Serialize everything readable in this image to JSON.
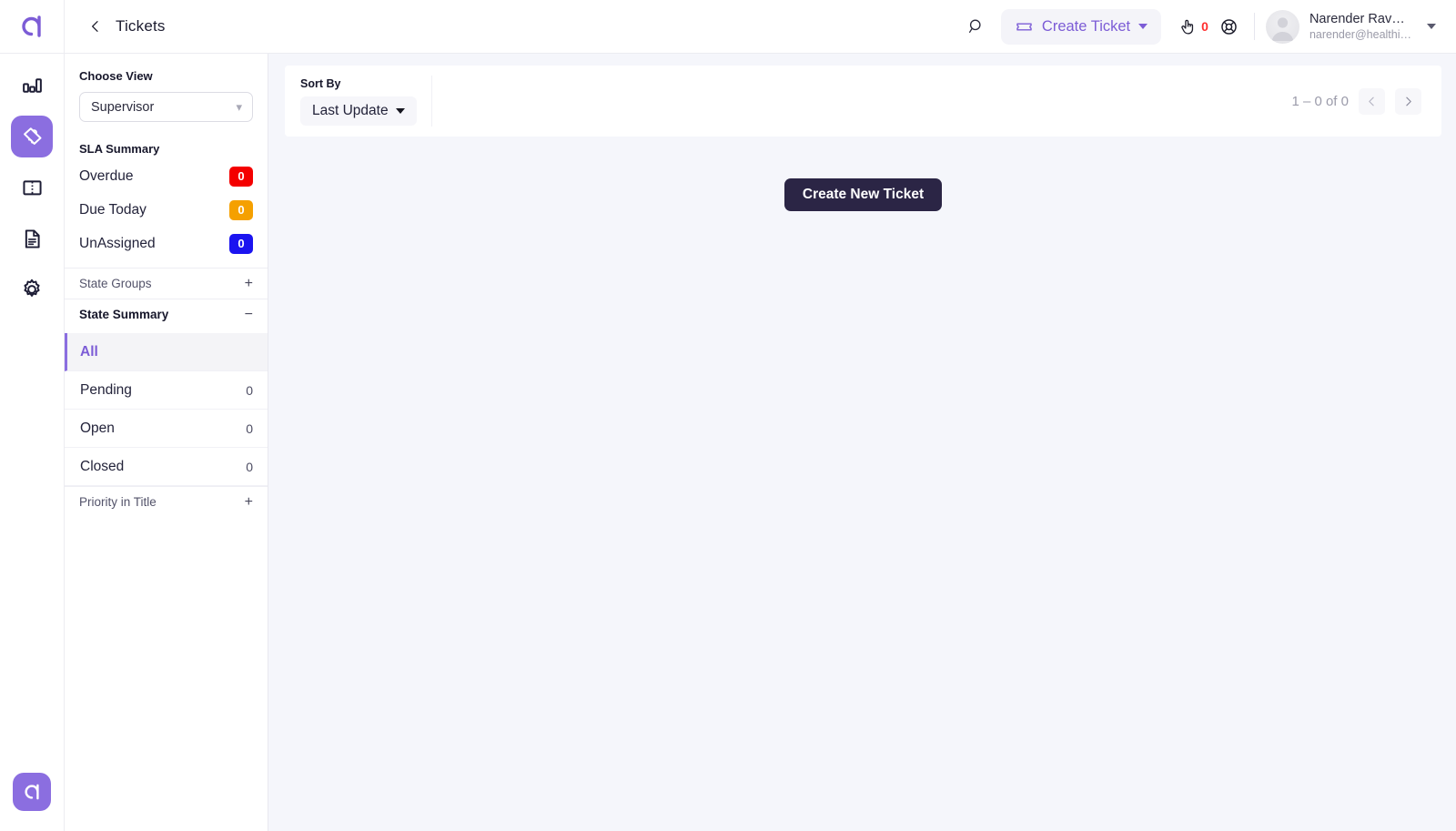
{
  "brand": {
    "logo_glyph": "a",
    "accent": "#8b6ee0",
    "bottom_logo_glyph": "a"
  },
  "rail": {
    "items": [
      {
        "name": "dashboard",
        "icon": "bar-chart-icon",
        "active": false
      },
      {
        "name": "tickets",
        "icon": "ticket-icon",
        "active": true
      },
      {
        "name": "knowledge-base",
        "icon": "book-icon",
        "active": false
      },
      {
        "name": "reports",
        "icon": "document-icon",
        "active": false
      },
      {
        "name": "settings",
        "icon": "gear-icon",
        "active": false
      }
    ]
  },
  "header": {
    "title": "Tickets",
    "back_icon": "chevron-left-icon",
    "search_icon": "search-icon",
    "create_ticket_label": "Create Ticket",
    "create_ticket_icon": "ticket-icon",
    "cursor_icon": "hand-pointer-icon",
    "cursor_badge": "0",
    "help_icon": "lifebuoy-icon",
    "user_name": "Narender Rav…",
    "user_email": "narender@healthi…"
  },
  "sidebar": {
    "choose_view_label": "Choose View",
    "choose_view_value": "Supervisor",
    "sla_summary_label": "SLA Summary",
    "sla_rows": [
      {
        "label": "Overdue",
        "count": "0",
        "color": "#f40000"
      },
      {
        "label": "Due Today",
        "count": "0",
        "color": "#f5a000"
      },
      {
        "label": "UnAssigned",
        "count": "0",
        "color": "#1b14f0"
      }
    ],
    "state_groups_label": "State Groups",
    "state_groups_sign": "+",
    "state_summary_label": "State Summary",
    "state_summary_sign": "−",
    "states": [
      {
        "label": "All",
        "count": "",
        "active": true
      },
      {
        "label": "Pending",
        "count": "0",
        "active": false
      },
      {
        "label": "Open",
        "count": "0",
        "active": false
      },
      {
        "label": "Closed",
        "count": "0",
        "active": false
      }
    ],
    "priority_label": "Priority in Title",
    "priority_sign": "+"
  },
  "toolbar": {
    "sort_by_label": "Sort By",
    "sort_value": "Last Update",
    "pagination_text": "1 – 0 of 0",
    "prev_icon": "chevron-left-icon",
    "next_icon": "chevron-right-icon"
  },
  "main": {
    "create_new_ticket_label": "Create New Ticket"
  }
}
